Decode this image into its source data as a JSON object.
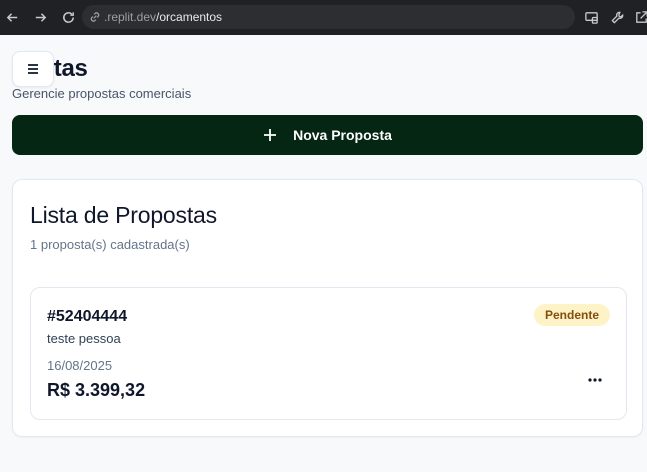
{
  "browser": {
    "url_host": ".replit.dev",
    "url_path": "/orcamentos",
    "icons": [
      "back-icon",
      "forward-icon",
      "reload-icon",
      "link-icon",
      "cast-icon",
      "wrench-icon",
      "external-icon"
    ]
  },
  "header": {
    "title": "postas",
    "subtitle": "Gerencie propostas comerciais",
    "menu_icon": "hamburger-menu-icon"
  },
  "actions": {
    "new_proposal_label": "Nova Proposta",
    "new_proposal_icon": "plus-icon"
  },
  "list": {
    "title": "Lista de Propostas",
    "count_text": "1 proposta(s) cadastrada(s)",
    "items": [
      {
        "id": "#52404444",
        "client": "teste pessoa",
        "date": "16/08/2025",
        "value": "R$ 3.399,32",
        "status": "Pendente",
        "more_icon": "more-horizontal-icon"
      }
    ]
  },
  "colors": {
    "primary": "#052613",
    "pending_badge_bg": "#fef3c7",
    "pending_badge_text": "#854d0e",
    "chrome_bg": "#202124"
  }
}
